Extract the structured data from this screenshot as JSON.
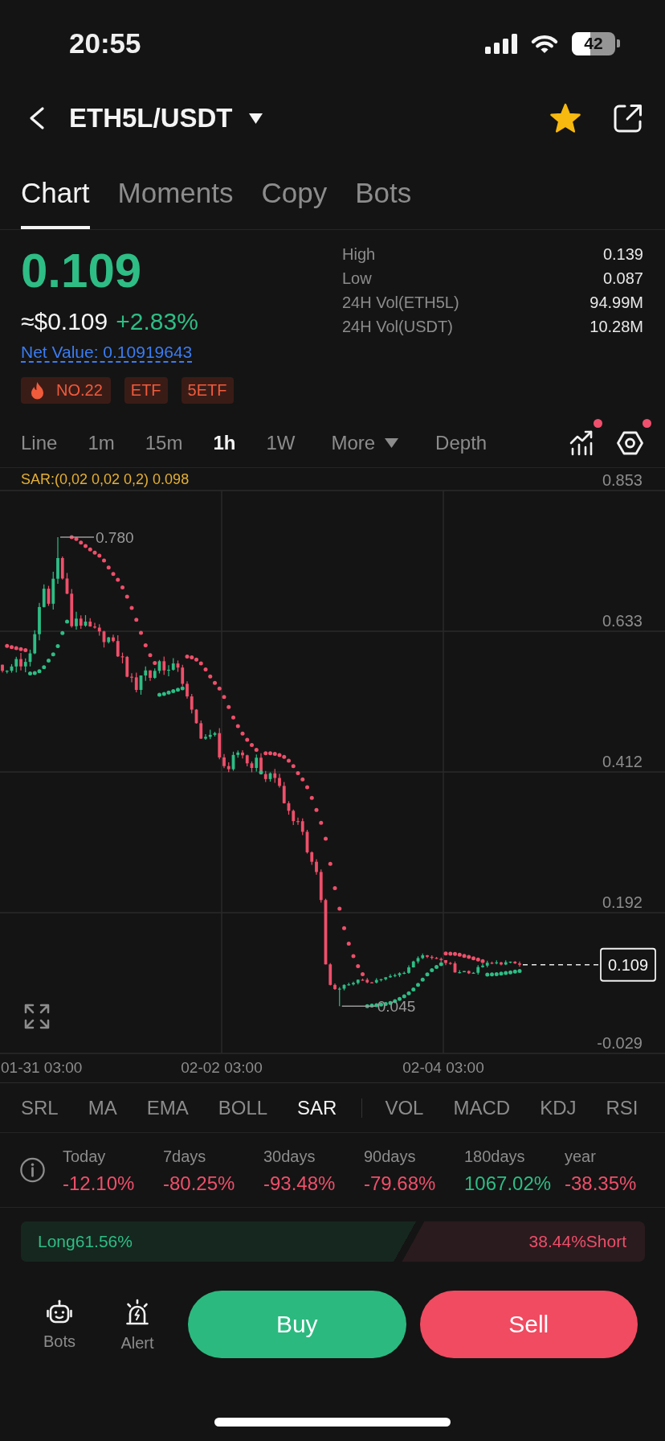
{
  "status_bar": {
    "time": "20:55",
    "battery": "42"
  },
  "header": {
    "title": "ETH5L/USDT",
    "favorite": true
  },
  "tabs": [
    {
      "label": "Chart",
      "selected": true
    },
    {
      "label": "Moments",
      "selected": false
    },
    {
      "label": "Copy",
      "selected": false
    },
    {
      "label": "Bots",
      "selected": false
    }
  ],
  "ticker": {
    "price": "0.109",
    "fiat_price": "≈$0.109",
    "change": "+2.83%",
    "net_value": "Net Value: 0.10919643",
    "tags": [
      {
        "label": "NO.22",
        "kind": "hot"
      },
      {
        "label": "ETF",
        "kind": "plain"
      },
      {
        "label": "5ETF",
        "kind": "plain"
      }
    ]
  },
  "stats": [
    {
      "label": "High",
      "value": "0.139"
    },
    {
      "label": "Low",
      "value": "0.087"
    },
    {
      "label": "24H Vol(ETH5L)",
      "value": "94.99M"
    },
    {
      "label": "24H Vol(USDT)",
      "value": "10.28M"
    }
  ],
  "intervals": [
    {
      "label": "Line",
      "kind": "option",
      "selected": false
    },
    {
      "label": "1m",
      "kind": "option",
      "selected": false
    },
    {
      "label": "15m",
      "kind": "option",
      "selected": false
    },
    {
      "label": "1h",
      "kind": "option",
      "selected": true
    },
    {
      "label": "1W",
      "kind": "option",
      "selected": false
    },
    {
      "label": "More",
      "kind": "dropdown",
      "selected": false
    },
    {
      "label": "Depth",
      "kind": "option",
      "selected": false
    }
  ],
  "chart_tools": [
    {
      "kind": "indicators",
      "badge": true
    },
    {
      "kind": "settings",
      "badge": true
    }
  ],
  "chart": {
    "indicator_readout": "SAR:(0,02 0,02 0,2) 0.098",
    "y_labels": [
      "0.853",
      "0.633",
      "0.412",
      "0.192",
      "-0.029"
    ],
    "x_labels": [
      "01-31 03:00",
      "02-02 03:00",
      "02-04 03:00"
    ],
    "high_marker": "0.780",
    "low_marker": "0.045",
    "last_price": "0.109"
  },
  "main_indicators": [
    {
      "label": "SRL",
      "selected": false
    },
    {
      "label": "MA",
      "selected": false
    },
    {
      "label": "EMA",
      "selected": false
    },
    {
      "label": "BOLL",
      "selected": false
    },
    {
      "label": "SAR",
      "selected": true
    }
  ],
  "sub_indicators": [
    {
      "label": "VOL",
      "selected": false
    },
    {
      "label": "MACD",
      "selected": false
    },
    {
      "label": "KDJ",
      "selected": false
    },
    {
      "label": "RSI",
      "selected": false
    }
  ],
  "returns": [
    {
      "period": "Today",
      "value": "-12.10%",
      "color": "#ef4f6a"
    },
    {
      "period": "7days",
      "value": "-80.25%",
      "color": "#ef4f6a"
    },
    {
      "period": "30days",
      "value": "-93.48%",
      "color": "#ef4f6a"
    },
    {
      "period": "90days",
      "value": "-79.68%",
      "color": "#ef4f6a"
    },
    {
      "period": "180days",
      "value": "1067.02%",
      "color": "#2ebd85"
    },
    {
      "period": "year",
      "value": "-38.35%",
      "color": "#ef4f6a"
    }
  ],
  "sentiment": {
    "long": "Long61.56%",
    "short": "38.44%Short",
    "level": 0.6156
  },
  "bottom_nav": [
    {
      "label": "Bots",
      "kind": "bots"
    },
    {
      "label": "Alert",
      "kind": "alert"
    }
  ],
  "actions": [
    {
      "label": "Buy",
      "kind": "buy"
    },
    {
      "label": "Sell",
      "kind": "sell"
    }
  ]
}
